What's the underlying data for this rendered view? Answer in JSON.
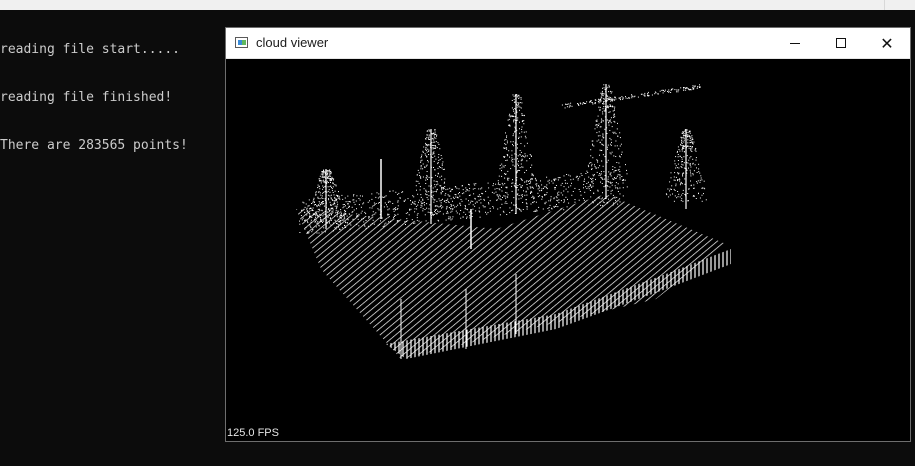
{
  "console": {
    "lines": [
      "reading file start.....",
      "reading file finished!",
      "There are 283565 points!"
    ]
  },
  "viewer": {
    "title": "cloud viewer",
    "fps_text": "125.0 FPS",
    "icons": {
      "app": "window-app-icon",
      "minimize": "minimize-icon",
      "maximize": "maximize-icon",
      "close": "close-icon"
    }
  },
  "colors": {
    "console_bg": "#0c0c0c",
    "console_text": "#cccccc",
    "viewer_bg": "#000000",
    "points": "#ffffff"
  }
}
